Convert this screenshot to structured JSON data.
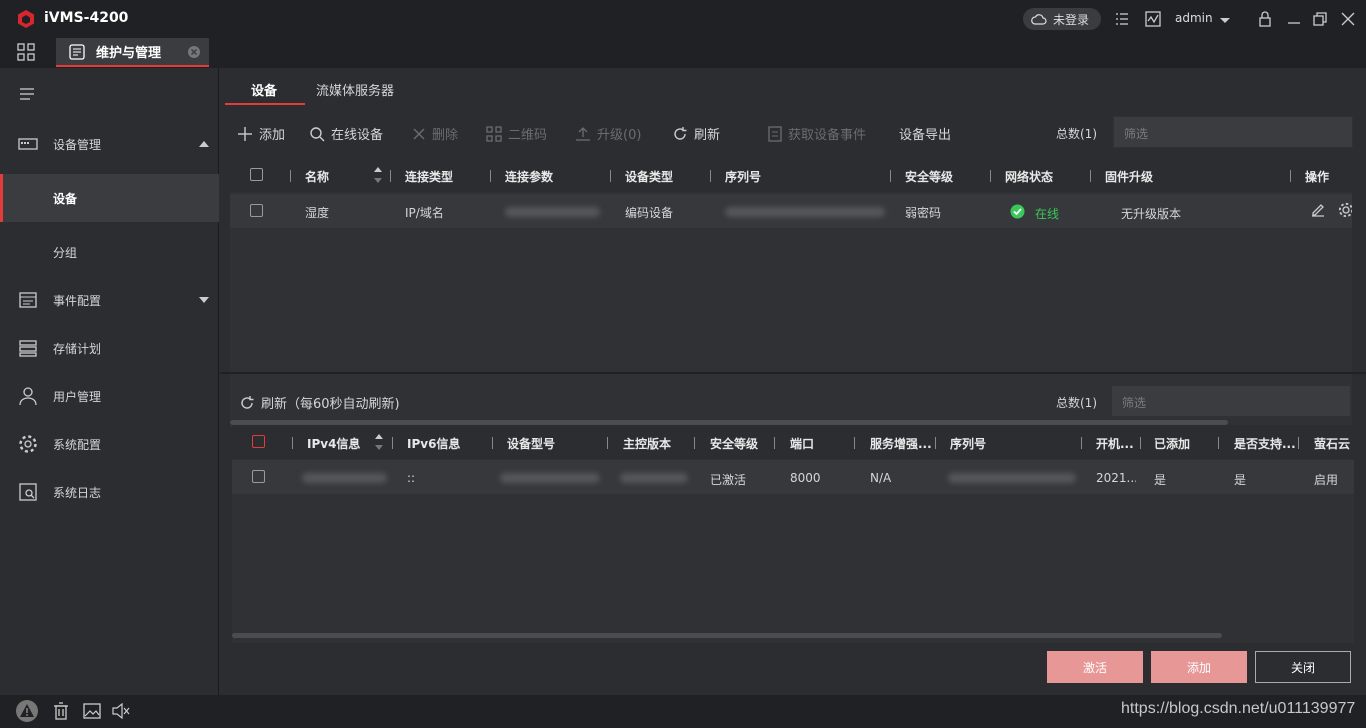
{
  "app": {
    "title": "iVMS-4200",
    "login_label": "未登录",
    "user": "admin"
  },
  "tab": {
    "label": "维护与管理"
  },
  "sidebar": {
    "items": [
      {
        "label": "设备管理"
      },
      {
        "label": "设备"
      },
      {
        "label": "分组"
      },
      {
        "label": "事件配置"
      },
      {
        "label": "存储计划"
      },
      {
        "label": "用户管理"
      },
      {
        "label": "系统配置"
      },
      {
        "label": "系统日志"
      }
    ]
  },
  "subtabs": [
    "设备",
    "流媒体服务器"
  ],
  "toolbar": {
    "add": "添加",
    "online": "在线设备",
    "delete": "删除",
    "qrcode": "二维码",
    "upgrade": "升级(0)",
    "refresh": "刷新",
    "get_events": "获取设备事件",
    "export": "设备导出",
    "total": "总数(1)",
    "filter_placeholder": "筛选"
  },
  "devices": {
    "columns": [
      "名称",
      "连接类型",
      "连接参数",
      "设备类型",
      "序列号",
      "安全等级",
      "网络状态",
      "固件升级",
      "操作"
    ],
    "rows": [
      {
        "name": "湿度",
        "conn_type": "IP/域名",
        "conn_param": "",
        "dev_type": "编码设备",
        "serial": "",
        "security": "弱密码",
        "status": "在线",
        "firmware": "无升级版本"
      }
    ]
  },
  "online": {
    "refresh_label": "刷新（每60秒自动刷新)",
    "total": "总数(1)",
    "filter_placeholder": "筛选",
    "columns": [
      "IPv4信息",
      "IPv6信息",
      "设备型号",
      "主控版本",
      "安全等级",
      "端口",
      "服务增强...",
      "序列号",
      "开机...",
      "已添加",
      "是否支持...",
      "萤石云"
    ],
    "rows": [
      {
        "ipv4": "",
        "ipv6": "::",
        "model": "",
        "firmware": "",
        "security": "已激活",
        "port": "8000",
        "service": "N/A",
        "serial": "",
        "boot": "2021...",
        "added": "是",
        "support": "是",
        "ezviz": "启用"
      }
    ]
  },
  "buttons": {
    "activate": "激活",
    "add": "添加",
    "close": "关闭"
  },
  "colors": {
    "accent": "#e63b3b",
    "online": "#3cc75a",
    "activate_bg": "#e89797",
    "add_bg": "#e89797"
  },
  "watermark": "https://blog.csdn.net/u011139977"
}
